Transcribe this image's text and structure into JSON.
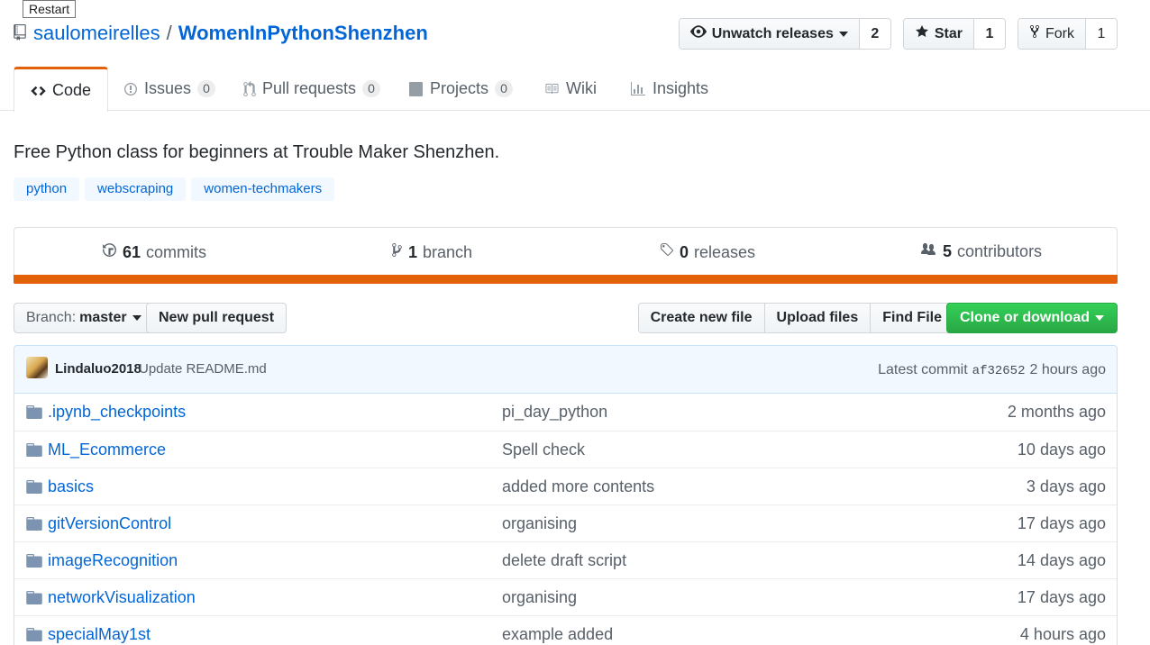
{
  "tooltip": "Restart",
  "repo": {
    "owner": "saulomeirelles",
    "separator": "/",
    "name": "WomenInPythonShenzhen"
  },
  "actions": {
    "watch": {
      "label": "Unwatch releases",
      "count": "2"
    },
    "star": {
      "label": "Star",
      "count": "1"
    },
    "fork": {
      "label": "Fork",
      "count": "1"
    }
  },
  "tabs": [
    {
      "label": "Code",
      "icon": "code-icon"
    },
    {
      "label": "Issues",
      "count": "0",
      "icon": "issue-icon"
    },
    {
      "label": "Pull requests",
      "count": "0",
      "icon": "pull-request-icon"
    },
    {
      "label": "Projects",
      "count": "0",
      "icon": "project-icon"
    },
    {
      "label": "Wiki",
      "icon": "book-icon"
    },
    {
      "label": "Insights",
      "icon": "graph-icon"
    }
  ],
  "description": "Free Python class for beginners at Trouble Maker Shenzhen.",
  "topics": [
    "python",
    "webscraping",
    "women-techmakers"
  ],
  "summary": {
    "commits": {
      "count": "61",
      "label": "commits"
    },
    "branches": {
      "count": "1",
      "label": "branch"
    },
    "releases": {
      "count": "0",
      "label": "releases"
    },
    "contributors": {
      "count": "5",
      "label": "contributors"
    }
  },
  "file_nav": {
    "branch_prefix": "Branch:",
    "branch": "master",
    "new_pull_request": "New pull request",
    "create_new_file": "Create new file",
    "upload_files": "Upload files",
    "find_file": "Find File",
    "clone": "Clone or download"
  },
  "latest_commit": {
    "author": "Lindaluo2018",
    "message": "Update README.md",
    "label": "Latest commit",
    "sha": "af32652",
    "age": "2 hours ago"
  },
  "files": [
    {
      "name": ".ipynb_checkpoints",
      "message": "pi_day_python",
      "age": "2 months ago"
    },
    {
      "name": "ML_Ecommerce",
      "message": "Spell check",
      "age": "10 days ago"
    },
    {
      "name": "basics",
      "message": "added more contents",
      "age": "3 days ago"
    },
    {
      "name": "gitVersionControl",
      "message": "organising",
      "age": "17 days ago"
    },
    {
      "name": "imageRecognition",
      "message": "delete draft script",
      "age": "14 days ago"
    },
    {
      "name": "networkVisualization",
      "message": "organising",
      "age": "17 days ago"
    },
    {
      "name": "specialMay1st",
      "message": "example added",
      "age": "4 hours ago"
    }
  ],
  "colors": {
    "accent_tab": "#e36209",
    "link": "#0366d6",
    "clone_green": "#28a745"
  }
}
